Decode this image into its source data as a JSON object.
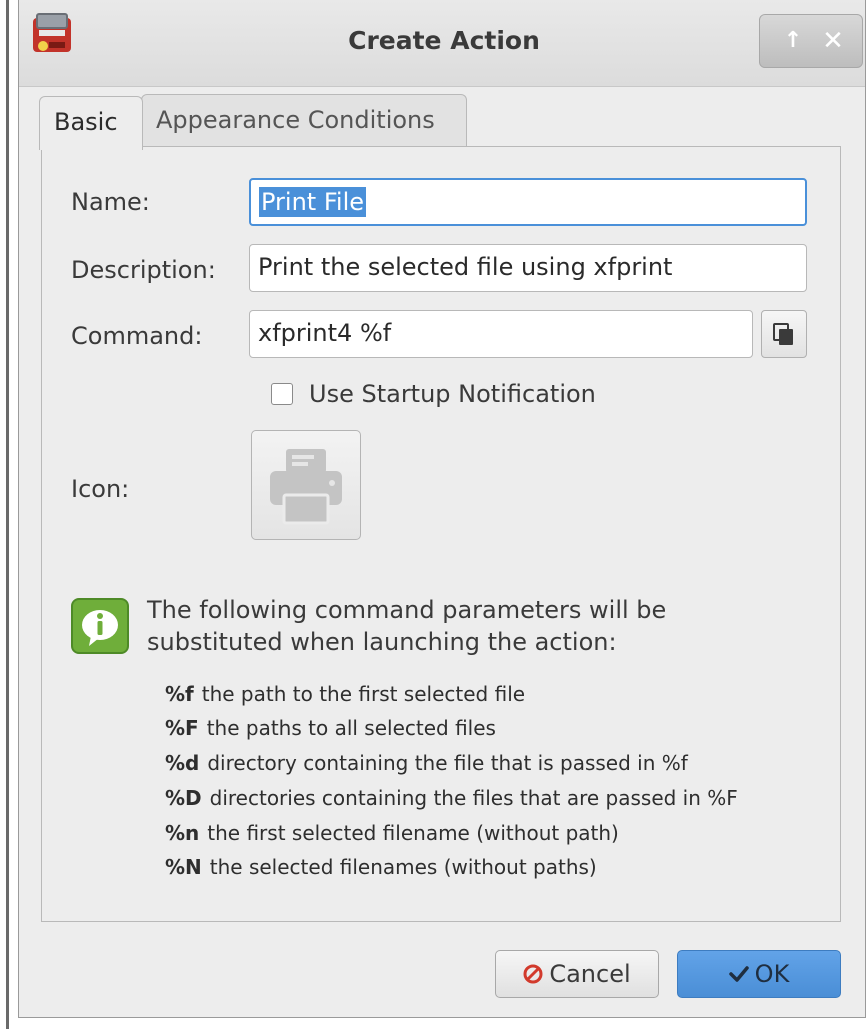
{
  "window": {
    "title": "Create Action",
    "buttons": {
      "up": "↑",
      "close": "✕"
    }
  },
  "tabs": [
    {
      "label": "Basic",
      "active": true
    },
    {
      "label": "Appearance Conditions",
      "active": false
    }
  ],
  "form": {
    "name_label": "Name:",
    "name_value": "Print File",
    "description_label": "Description:",
    "description_value": "Print the selected file using xfprint",
    "command_label": "Command:",
    "command_value": "xfprint4 %f",
    "startup_notification_label": "Use Startup Notification",
    "startup_notification_checked": false,
    "icon_label": "Icon:",
    "icon_name": "printer-icon"
  },
  "info": {
    "text_line1": "The following command parameters will be",
    "text_line2": "substituted when launching the action:",
    "params": [
      {
        "code": "%f",
        "desc": "the path to the first selected file"
      },
      {
        "code": "%F",
        "desc": "the paths to all selected files"
      },
      {
        "code": "%d",
        "desc": "directory containing the file that is passed in %f"
      },
      {
        "code": "%D",
        "desc": "directories containing the files that are passed in %F"
      },
      {
        "code": "%n",
        "desc": "the first selected filename (without path)"
      },
      {
        "code": "%N",
        "desc": "the selected filenames (without paths)"
      }
    ]
  },
  "buttons": {
    "cancel_label": "Cancel",
    "ok_label": "OK"
  },
  "colors": {
    "accent": "#4a90d9",
    "info_icon": "#6fae3a",
    "cancel_icon": "#d23a2c"
  }
}
